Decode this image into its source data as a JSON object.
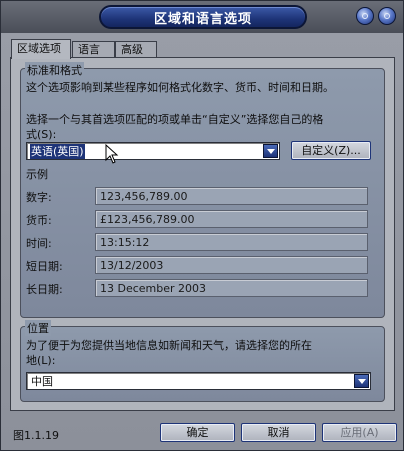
{
  "window": {
    "title": "区域和语言选项"
  },
  "tabs": [
    {
      "label": "区域选项"
    },
    {
      "label": "语言"
    },
    {
      "label": "高级"
    }
  ],
  "standards": {
    "group_title": "标准和格式",
    "description": "这个选项影响到某些程序如何格式化数字、货币、时间和日期。",
    "instruction_line1": "选择一个与其首选项匹配的项或单击“自定义”选择您自己的格",
    "instruction_line2": "式(S):",
    "selected_locale": "英语(英国)",
    "customize_label": "自定义(Z)...",
    "samples_label": "示例",
    "samples": [
      {
        "label": "数字:",
        "value": "123,456,789.00"
      },
      {
        "label": "货币:",
        "value": "£123,456,789.00"
      },
      {
        "label": "时间:",
        "value": "13:15:12"
      },
      {
        "label": "短日期:",
        "value": "13/12/2003"
      },
      {
        "label": "长日期:",
        "value": "13 December 2003"
      }
    ]
  },
  "location": {
    "group_title": "位置",
    "description_line1": "为了便于为您提供当地信息如新闻和天气，请选择您的所在",
    "description_line2": "地(L):",
    "selected": "中国"
  },
  "footer": {
    "figure_label": "图1.1.19",
    "ok_label": "确定",
    "cancel_label": "取消",
    "apply_label": "应用(A)"
  },
  "colors": {
    "title_accent": "#1e3478",
    "selection": "#1e3478"
  }
}
